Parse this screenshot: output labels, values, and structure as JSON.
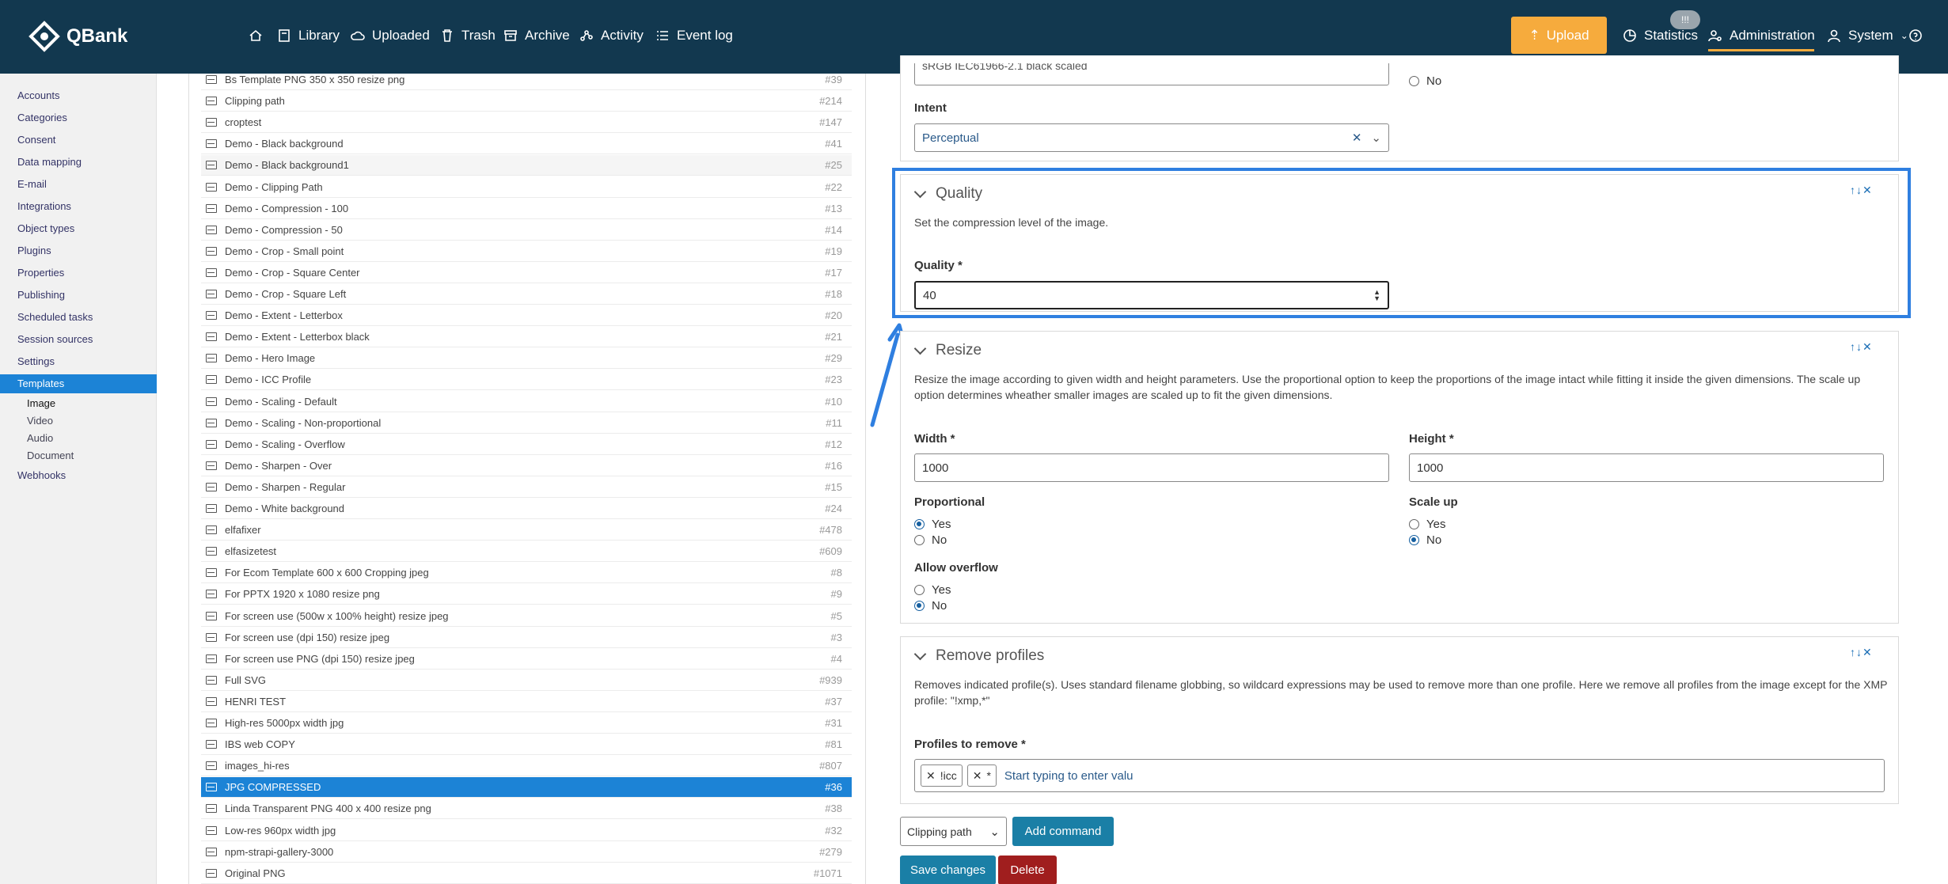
{
  "app": {
    "brand": "QBank"
  },
  "nav": {
    "home_label": "",
    "items": [
      "Library",
      "Uploaded",
      "Trash",
      "Archive",
      "Activity",
      "Event log"
    ],
    "upload_label": "Upload",
    "badge": "!!!",
    "statistics": "Statistics",
    "administration": "Administration",
    "system": "System",
    "help_icon": "question-circle-icon",
    "accent": "#f6ab3d",
    "bar_color": "#12384f"
  },
  "sidebar": {
    "items": [
      "Accounts",
      "Categories",
      "Consent",
      "Data mapping",
      "E-mail",
      "Integrations",
      "Object types",
      "Plugins",
      "Properties",
      "Publishing",
      "Scheduled tasks",
      "Session sources",
      "Settings",
      "Templates"
    ],
    "sub_items": [
      "Image",
      "Video",
      "Audio",
      "Document"
    ],
    "after": [
      "Webhooks"
    ],
    "active": "Templates",
    "active_sub": "Image"
  },
  "templates": [
    {
      "name": "Bs Template PNG 350 x 350 resize png",
      "id": "#39"
    },
    {
      "name": "Clipping path",
      "id": "#214"
    },
    {
      "name": "croptest",
      "id": "#147"
    },
    {
      "name": "Demo - Black background",
      "id": "#41"
    },
    {
      "name": "Demo - Black background1",
      "id": "#25"
    },
    {
      "name": "Demo - Clipping Path",
      "id": "#22"
    },
    {
      "name": "Demo - Compression - 100",
      "id": "#13"
    },
    {
      "name": "Demo - Compression - 50",
      "id": "#14"
    },
    {
      "name": "Demo - Crop - Small point",
      "id": "#19"
    },
    {
      "name": "Demo - Crop - Square Center",
      "id": "#17"
    },
    {
      "name": "Demo - Crop - Square Left",
      "id": "#18"
    },
    {
      "name": "Demo - Extent - Letterbox",
      "id": "#20"
    },
    {
      "name": "Demo - Extent - Letterbox black",
      "id": "#21"
    },
    {
      "name": "Demo - Hero Image",
      "id": "#29"
    },
    {
      "name": "Demo - ICC Profile",
      "id": "#23"
    },
    {
      "name": "Demo - Scaling - Default",
      "id": "#10"
    },
    {
      "name": "Demo - Scaling - Non-proportional",
      "id": "#11"
    },
    {
      "name": "Demo - Scaling - Overflow",
      "id": "#12"
    },
    {
      "name": "Demo - Sharpen - Over",
      "id": "#16"
    },
    {
      "name": "Demo - Sharpen - Regular",
      "id": "#15"
    },
    {
      "name": "Demo - White background",
      "id": "#24"
    },
    {
      "name": "elfafixer",
      "id": "#478"
    },
    {
      "name": "elfasizetest",
      "id": "#609"
    },
    {
      "name": "For Ecom Template 600 x 600 Cropping jpeg",
      "id": "#8"
    },
    {
      "name": "For PPTX 1920 x 1080 resize png",
      "id": "#9"
    },
    {
      "name": "For screen use (500w x 100% height) resize jpeg",
      "id": "#5"
    },
    {
      "name": "For screen use (dpi 150) resize jpeg",
      "id": "#3"
    },
    {
      "name": "For screen use PNG (dpi 150) resize jpeg",
      "id": "#4"
    },
    {
      "name": "Full SVG",
      "id": "#939"
    },
    {
      "name": "HENRI TEST",
      "id": "#37"
    },
    {
      "name": "High-res 5000px width jpg",
      "id": "#31"
    },
    {
      "name": "IBS web COPY",
      "id": "#81"
    },
    {
      "name": "images_hi-res",
      "id": "#807"
    },
    {
      "name": "JPG COMPRESSED",
      "id": "#36"
    },
    {
      "name": "Linda Transparent PNG 400 x 400 resize png",
      "id": "#38"
    },
    {
      "name": "Low-res 960px width jpg",
      "id": "#32"
    },
    {
      "name": "npm-strapi-gallery-3000",
      "id": "#279"
    },
    {
      "name": "Original PNG",
      "id": "#1071"
    }
  ],
  "selected_template": "JPG COMPRESSED",
  "editor": {
    "top_partial": {
      "profile_value": "sRGB IEC61966-2.1 black scaled",
      "no_label": "No",
      "intent_label": "Intent",
      "intent_value": "Perceptual"
    },
    "quality": {
      "title": "Quality",
      "desc": "Set the compression level of the image.",
      "field_label": "Quality *",
      "value": "40"
    },
    "resize": {
      "title": "Resize",
      "desc": "Resize the image according to given width and height parameters. Use the proportional option to keep the proportions of the image intact while fitting it inside the given dimensions. The scale up option determines wheather smaller images are scaled up to fit the given dimensions.",
      "width_label": "Width *",
      "width_value": "1000",
      "height_label": "Height *",
      "height_value": "1000",
      "proportional_label": "Proportional",
      "scaleup_label": "Scale up",
      "overflow_label": "Allow overflow",
      "yes": "Yes",
      "no": "No",
      "proportional": "Yes",
      "scaleup": "No",
      "overflow": "No"
    },
    "remove_profiles": {
      "title": "Remove profiles",
      "desc": "Removes indicated profile(s). Uses standard filename globbing, so wildcard expressions may be used to remove more than one profile. Here we remove all profiles from the image except for the XMP profile: \"!xmp,*\"",
      "field_label": "Profiles to remove *",
      "tags": [
        "!icc",
        "*"
      ],
      "placeholder": "Start typing to enter valu"
    },
    "command_select": "Clipping path",
    "add_command": "Add command",
    "save": "Save changes",
    "delete": "Delete",
    "highlight_color": "#2f7fe0"
  }
}
